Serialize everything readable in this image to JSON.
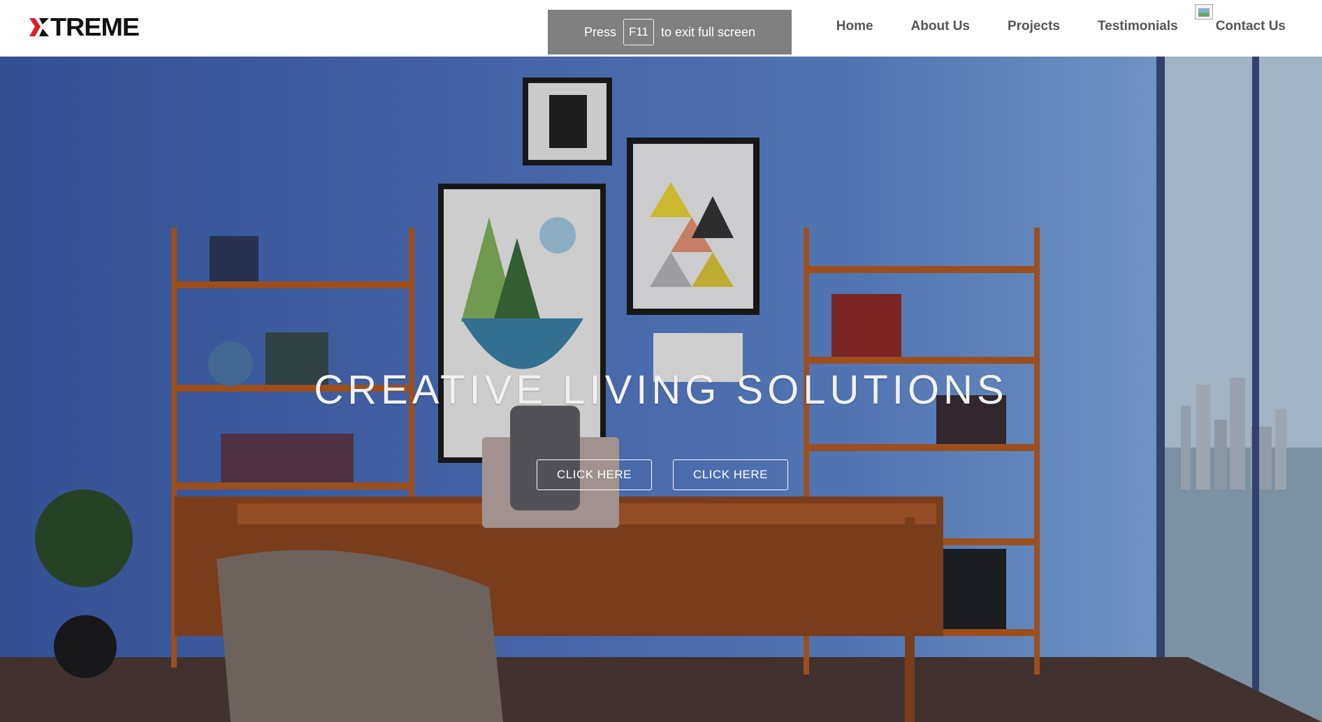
{
  "brand": {
    "logo_text": "TREME",
    "logo_alt": "XTREME"
  },
  "toast": {
    "before": "Press",
    "key": "F11",
    "after": "to exit full screen"
  },
  "nav": {
    "items": [
      "Home",
      "About Us",
      "Projects",
      "Testimonials",
      "Contact Us"
    ]
  },
  "hero": {
    "title": "CREATIVE  LIVING SOLUTIONS",
    "buttons": [
      "CLICK HERE",
      "CLICK HERE"
    ]
  },
  "colors": {
    "accent": "#e31b23",
    "nav_text": "#555555",
    "wall": "#4c70bd",
    "wood": "#b25a22"
  }
}
